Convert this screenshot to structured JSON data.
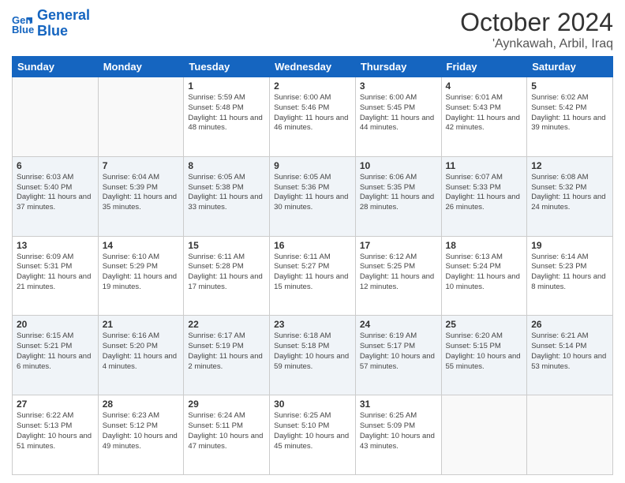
{
  "logo": {
    "line1": "General",
    "line2": "Blue"
  },
  "title": "October 2024",
  "subtitle": "'Aynkawah, Arbil, Iraq",
  "days_of_week": [
    "Sunday",
    "Monday",
    "Tuesday",
    "Wednesday",
    "Thursday",
    "Friday",
    "Saturday"
  ],
  "weeks": [
    [
      {
        "num": "",
        "sunrise": "",
        "sunset": "",
        "daylight": ""
      },
      {
        "num": "",
        "sunrise": "",
        "sunset": "",
        "daylight": ""
      },
      {
        "num": "1",
        "sunrise": "Sunrise: 5:59 AM",
        "sunset": "Sunset: 5:48 PM",
        "daylight": "Daylight: 11 hours and 48 minutes."
      },
      {
        "num": "2",
        "sunrise": "Sunrise: 6:00 AM",
        "sunset": "Sunset: 5:46 PM",
        "daylight": "Daylight: 11 hours and 46 minutes."
      },
      {
        "num": "3",
        "sunrise": "Sunrise: 6:00 AM",
        "sunset": "Sunset: 5:45 PM",
        "daylight": "Daylight: 11 hours and 44 minutes."
      },
      {
        "num": "4",
        "sunrise": "Sunrise: 6:01 AM",
        "sunset": "Sunset: 5:43 PM",
        "daylight": "Daylight: 11 hours and 42 minutes."
      },
      {
        "num": "5",
        "sunrise": "Sunrise: 6:02 AM",
        "sunset": "Sunset: 5:42 PM",
        "daylight": "Daylight: 11 hours and 39 minutes."
      }
    ],
    [
      {
        "num": "6",
        "sunrise": "Sunrise: 6:03 AM",
        "sunset": "Sunset: 5:40 PM",
        "daylight": "Daylight: 11 hours and 37 minutes."
      },
      {
        "num": "7",
        "sunrise": "Sunrise: 6:04 AM",
        "sunset": "Sunset: 5:39 PM",
        "daylight": "Daylight: 11 hours and 35 minutes."
      },
      {
        "num": "8",
        "sunrise": "Sunrise: 6:05 AM",
        "sunset": "Sunset: 5:38 PM",
        "daylight": "Daylight: 11 hours and 33 minutes."
      },
      {
        "num": "9",
        "sunrise": "Sunrise: 6:05 AM",
        "sunset": "Sunset: 5:36 PM",
        "daylight": "Daylight: 11 hours and 30 minutes."
      },
      {
        "num": "10",
        "sunrise": "Sunrise: 6:06 AM",
        "sunset": "Sunset: 5:35 PM",
        "daylight": "Daylight: 11 hours and 28 minutes."
      },
      {
        "num": "11",
        "sunrise": "Sunrise: 6:07 AM",
        "sunset": "Sunset: 5:33 PM",
        "daylight": "Daylight: 11 hours and 26 minutes."
      },
      {
        "num": "12",
        "sunrise": "Sunrise: 6:08 AM",
        "sunset": "Sunset: 5:32 PM",
        "daylight": "Daylight: 11 hours and 24 minutes."
      }
    ],
    [
      {
        "num": "13",
        "sunrise": "Sunrise: 6:09 AM",
        "sunset": "Sunset: 5:31 PM",
        "daylight": "Daylight: 11 hours and 21 minutes."
      },
      {
        "num": "14",
        "sunrise": "Sunrise: 6:10 AM",
        "sunset": "Sunset: 5:29 PM",
        "daylight": "Daylight: 11 hours and 19 minutes."
      },
      {
        "num": "15",
        "sunrise": "Sunrise: 6:11 AM",
        "sunset": "Sunset: 5:28 PM",
        "daylight": "Daylight: 11 hours and 17 minutes."
      },
      {
        "num": "16",
        "sunrise": "Sunrise: 6:11 AM",
        "sunset": "Sunset: 5:27 PM",
        "daylight": "Daylight: 11 hours and 15 minutes."
      },
      {
        "num": "17",
        "sunrise": "Sunrise: 6:12 AM",
        "sunset": "Sunset: 5:25 PM",
        "daylight": "Daylight: 11 hours and 12 minutes."
      },
      {
        "num": "18",
        "sunrise": "Sunrise: 6:13 AM",
        "sunset": "Sunset: 5:24 PM",
        "daylight": "Daylight: 11 hours and 10 minutes."
      },
      {
        "num": "19",
        "sunrise": "Sunrise: 6:14 AM",
        "sunset": "Sunset: 5:23 PM",
        "daylight": "Daylight: 11 hours and 8 minutes."
      }
    ],
    [
      {
        "num": "20",
        "sunrise": "Sunrise: 6:15 AM",
        "sunset": "Sunset: 5:21 PM",
        "daylight": "Daylight: 11 hours and 6 minutes."
      },
      {
        "num": "21",
        "sunrise": "Sunrise: 6:16 AM",
        "sunset": "Sunset: 5:20 PM",
        "daylight": "Daylight: 11 hours and 4 minutes."
      },
      {
        "num": "22",
        "sunrise": "Sunrise: 6:17 AM",
        "sunset": "Sunset: 5:19 PM",
        "daylight": "Daylight: 11 hours and 2 minutes."
      },
      {
        "num": "23",
        "sunrise": "Sunrise: 6:18 AM",
        "sunset": "Sunset: 5:18 PM",
        "daylight": "Daylight: 10 hours and 59 minutes."
      },
      {
        "num": "24",
        "sunrise": "Sunrise: 6:19 AM",
        "sunset": "Sunset: 5:17 PM",
        "daylight": "Daylight: 10 hours and 57 minutes."
      },
      {
        "num": "25",
        "sunrise": "Sunrise: 6:20 AM",
        "sunset": "Sunset: 5:15 PM",
        "daylight": "Daylight: 10 hours and 55 minutes."
      },
      {
        "num": "26",
        "sunrise": "Sunrise: 6:21 AM",
        "sunset": "Sunset: 5:14 PM",
        "daylight": "Daylight: 10 hours and 53 minutes."
      }
    ],
    [
      {
        "num": "27",
        "sunrise": "Sunrise: 6:22 AM",
        "sunset": "Sunset: 5:13 PM",
        "daylight": "Daylight: 10 hours and 51 minutes."
      },
      {
        "num": "28",
        "sunrise": "Sunrise: 6:23 AM",
        "sunset": "Sunset: 5:12 PM",
        "daylight": "Daylight: 10 hours and 49 minutes."
      },
      {
        "num": "29",
        "sunrise": "Sunrise: 6:24 AM",
        "sunset": "Sunset: 5:11 PM",
        "daylight": "Daylight: 10 hours and 47 minutes."
      },
      {
        "num": "30",
        "sunrise": "Sunrise: 6:25 AM",
        "sunset": "Sunset: 5:10 PM",
        "daylight": "Daylight: 10 hours and 45 minutes."
      },
      {
        "num": "31",
        "sunrise": "Sunrise: 6:25 AM",
        "sunset": "Sunset: 5:09 PM",
        "daylight": "Daylight: 10 hours and 43 minutes."
      },
      {
        "num": "",
        "sunrise": "",
        "sunset": "",
        "daylight": ""
      },
      {
        "num": "",
        "sunrise": "",
        "sunset": "",
        "daylight": ""
      }
    ]
  ]
}
